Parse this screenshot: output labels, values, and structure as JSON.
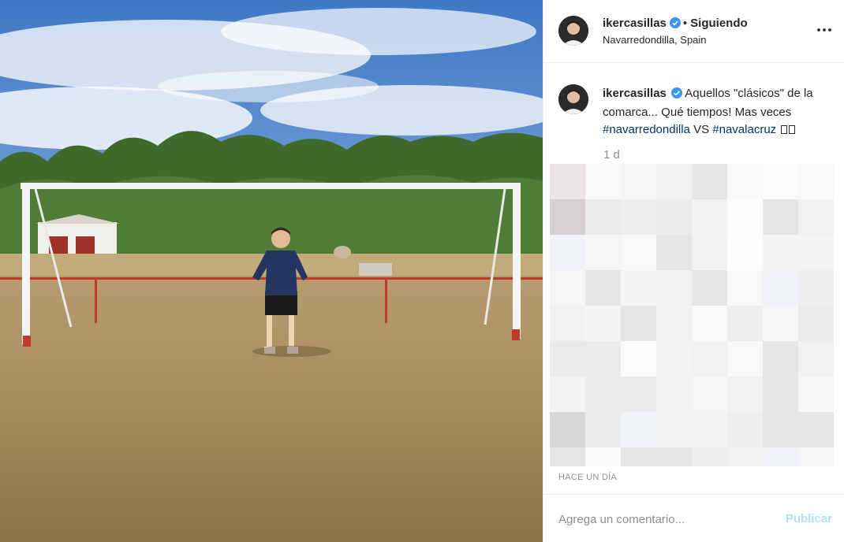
{
  "post": {
    "author": {
      "username": "ikercasillas",
      "verified": true,
      "follow_status": "Siguiendo",
      "location": "Navarredondilla, Spain"
    },
    "photo": {
      "subject": "man standing in front of a football goal on a dry grass field"
    },
    "caption": {
      "username": "ikercasillas",
      "text": "Aquellos \"clásicos\" de la comarca... Qué tiempos! Mas veces",
      "hashtag1": "#navarredondilla",
      "vs": "VS",
      "hashtag2": "#navalacruz",
      "age": "1 d"
    },
    "timestamp": "HACE UN DÍA",
    "comment": {
      "placeholder": "Agrega un comentario...",
      "post_label": "Publicar"
    },
    "icons": {
      "verified": "verified-badge-icon",
      "more": "more-options-icon"
    },
    "colors": {
      "link": "#003569",
      "verified": "#3897f0",
      "muted": "#8e8e8e",
      "post_disabled": "#b2dffc"
    }
  }
}
